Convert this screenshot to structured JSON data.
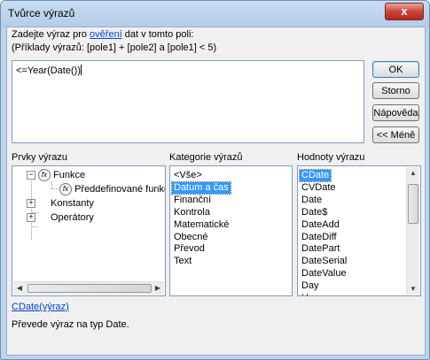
{
  "window": {
    "title": "Tvůrce výrazů",
    "close_glyph": "x"
  },
  "prompt": {
    "line1_before": "Zadejte výraz pro ",
    "line1_link": "ověření",
    "line1_after": " dat v tomto poli:",
    "line2": "(Příklady výrazů: [pole1] + [pole2] a [pole1] < 5)"
  },
  "expression": {
    "value": "<=Year(Date())"
  },
  "buttons": {
    "ok": "OK",
    "cancel": "Storno",
    "help": "Nápověda",
    "less": "<< Méně"
  },
  "elements": {
    "label": "Prvky výrazu",
    "tree": {
      "functions": "Funkce",
      "builtin": "Předdefinované funkce",
      "constants": "Konstanty",
      "operators": "Operátory"
    }
  },
  "categories": {
    "label": "Kategorie výrazů",
    "items": [
      "<Vše>",
      "Datum a čas",
      "Finanční",
      "Kontrola",
      "Matematické",
      "Obecné",
      "Převod",
      "Text"
    ],
    "selected_index": 1
  },
  "values": {
    "label": "Hodnoty výrazu",
    "items": [
      "CDate",
      "CVDate",
      "Date",
      "Date$",
      "DateAdd",
      "DateDiff",
      "DatePart",
      "DateSerial",
      "DateValue",
      "Day",
      "Hour"
    ],
    "selected_index": 0
  },
  "syntax": {
    "link": "CDate(výraz)",
    "description": "Převede výraz na typ Date."
  },
  "colors": {
    "selection": "#3399ff",
    "link": "#0044cc",
    "title_bar": "#bcd3ec",
    "close_button": "#c9463a"
  }
}
